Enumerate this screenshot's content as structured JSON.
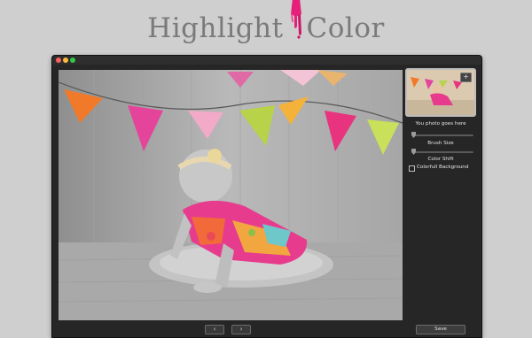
{
  "headline": {
    "part1": "Highlight",
    "part2": "Color"
  },
  "colors": {
    "brand_pink": "#e6207a",
    "window_bg": "#262626",
    "page_bg": "#cfcfcf"
  },
  "sidebar": {
    "thumbnail_button": "+",
    "thumbnail_caption": "You photo goes here",
    "brush_size_label": "Brush Size",
    "color_shift_label": "Color Shift",
    "colorful_background_label": "Colorfull Background",
    "colorful_background_checked": false
  },
  "toolbar": {
    "prev_label": "‹",
    "next_label": "›",
    "save_label": "Save"
  },
  "icons": [
    "paint-brush-icon",
    "chevron-left-icon",
    "chevron-right-icon",
    "plus-icon"
  ]
}
